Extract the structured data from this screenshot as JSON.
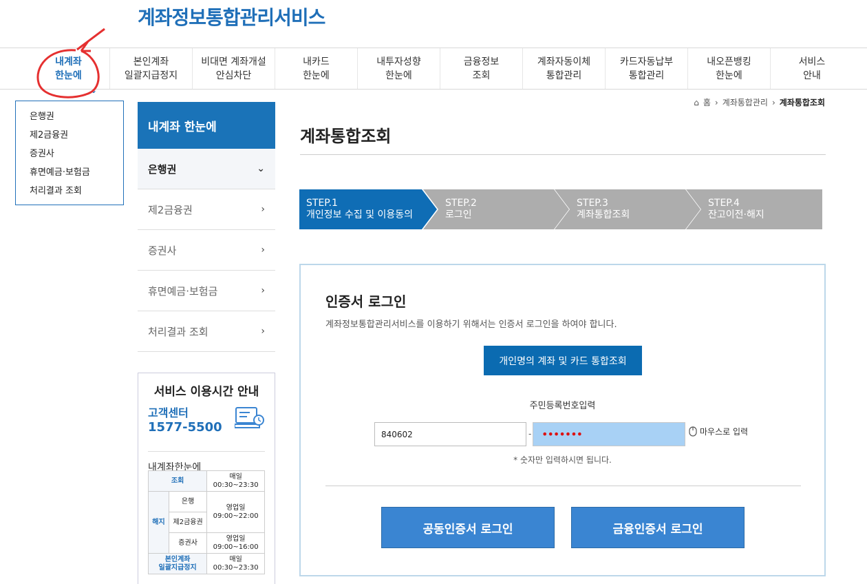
{
  "site": {
    "title": "계좌정보통합관리서비스"
  },
  "gnb": [
    {
      "label": "내계좌\n한눈에"
    },
    {
      "label": "본인계좌\n일괄지급정지"
    },
    {
      "label": "비대면 계좌개설\n안심차단"
    },
    {
      "label": "내카드\n한눈에"
    },
    {
      "label": "내투자성향\n한눈에"
    },
    {
      "label": "금융정보\n조회"
    },
    {
      "label": "계좌자동이체\n통합관리"
    },
    {
      "label": "카드자동납부\n통합관리"
    },
    {
      "label": "내오픈뱅킹\n한눈에"
    },
    {
      "label": "서비스\n안내"
    }
  ],
  "dropdown": [
    "은행권",
    "제2금융권",
    "증권사",
    "휴면예금·보험금",
    "처리결과 조회"
  ],
  "sidebar": {
    "title": "내계좌 한눈에",
    "items": [
      {
        "label": "은행권"
      },
      {
        "label": "제2금융권"
      },
      {
        "label": "증권사"
      },
      {
        "label": "휴면예금·보험금"
      },
      {
        "label": "처리결과 조회"
      }
    ]
  },
  "service_box": {
    "title": "서비스 이용시간 안내",
    "cc_label": "고객센터",
    "cc_phone": "1577-5500",
    "sub": "내계좌한눈에",
    "table": {
      "row1": {
        "head": "조회",
        "hours": "매일\n00:30~23:30"
      },
      "cancel_head": "해지",
      "bank": "은행",
      "second": "제2금융권",
      "cancel_hours": "영업일\n09:00~22:00",
      "securities": "증권사",
      "securities_hours": "영업일\n09:00~16:00",
      "stop_head": "본인계좌\n일괄지급정지",
      "stop_hours": "매일\n00:30~23:30"
    }
  },
  "breadcrumb": {
    "home": "홈",
    "mid": "계좌통합관리",
    "current": "계좌통합조회"
  },
  "page_title": "계좌통합조회",
  "steps": [
    {
      "no": "STEP.1",
      "label": "개인정보 수집 및 이용동의"
    },
    {
      "no": "STEP.2",
      "label": "로그인"
    },
    {
      "no": "STEP.3",
      "label": "계좌통합조회"
    },
    {
      "no": "STEP.4",
      "label": "잔고이전·해지"
    }
  ],
  "login": {
    "title": "인증서 로그인",
    "desc": "계좌정보통합관리서비스를 이용하기 위해서는 인증서 로그인을 하여야 합니다.",
    "integrated_btn": "개인명의 계좌 및 카드 통합조회",
    "rrn_label": "주민등록번호입력",
    "rrn_front": "840602",
    "dash": "-",
    "rrn_back_masked": "•••••••",
    "mouse_input": "마우스로 입력",
    "hint": "* 숫자만 입력하시면 됩니다.",
    "btn_joint": "공동인증서 로그인",
    "btn_financial": "금융인증서 로그인"
  },
  "colors": {
    "brand": "#1f6fb8",
    "step_active": "#0f6db5",
    "step_inactive": "#adadad",
    "button": "#3a85d2",
    "annotation": "#e53030"
  }
}
